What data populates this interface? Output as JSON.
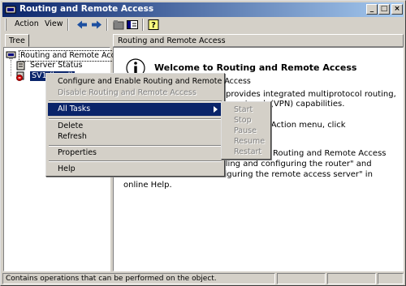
{
  "window": {
    "title": "Routing and Remote Access",
    "controls": {
      "minimize": "_",
      "maximize": "□",
      "close": "×"
    }
  },
  "menubar": {
    "action": "Action",
    "view": "View"
  },
  "toolbar": {
    "icons": [
      "back-arrow-icon",
      "forward-arrow-icon",
      "up-folder-icon",
      "show-hide-tree-icon",
      "help-icon"
    ]
  },
  "tree": {
    "tab_label": "Tree",
    "root": "Routing and Remote Access",
    "items": [
      {
        "label": "Server Status"
      },
      {
        "label": "SV1 (local)"
      }
    ]
  },
  "details": {
    "header": "Routing and Remote Access",
    "welcome_title": "Welcome to Routing and Remote Access",
    "lines": [
      "provides integrated multiprotocol routing,",
      "te network (VPN) capabilities.",
      "ver, on the Action menu, click",
      "Routing and Remote Access",
      "lling and configuring the router\" and",
      "figuring the remote access server\" in",
      "online Help."
    ]
  },
  "context_menu": {
    "items": [
      {
        "label": "Configure and Enable Routing and Remote Access",
        "state": "enabled"
      },
      {
        "label": "Disable Routing and Remote Access",
        "state": "disabled"
      },
      {
        "label": "All Tasks",
        "state": "active"
      },
      {
        "label": "Delete",
        "state": "enabled"
      },
      {
        "label": "Refresh",
        "state": "enabled"
      },
      {
        "label": "Properties",
        "state": "enabled"
      },
      {
        "label": "Help",
        "state": "enabled"
      }
    ],
    "submenu": [
      "Start",
      "Stop",
      "Pause",
      "Resume",
      "Restart"
    ]
  },
  "statusbar": {
    "text": "Contains operations that can be performed on the object."
  },
  "colors": {
    "title_gradient_start": "#0a246a",
    "title_gradient_end": "#a6caf0",
    "highlight": "#0a246a",
    "face": "#d4d0c8"
  }
}
